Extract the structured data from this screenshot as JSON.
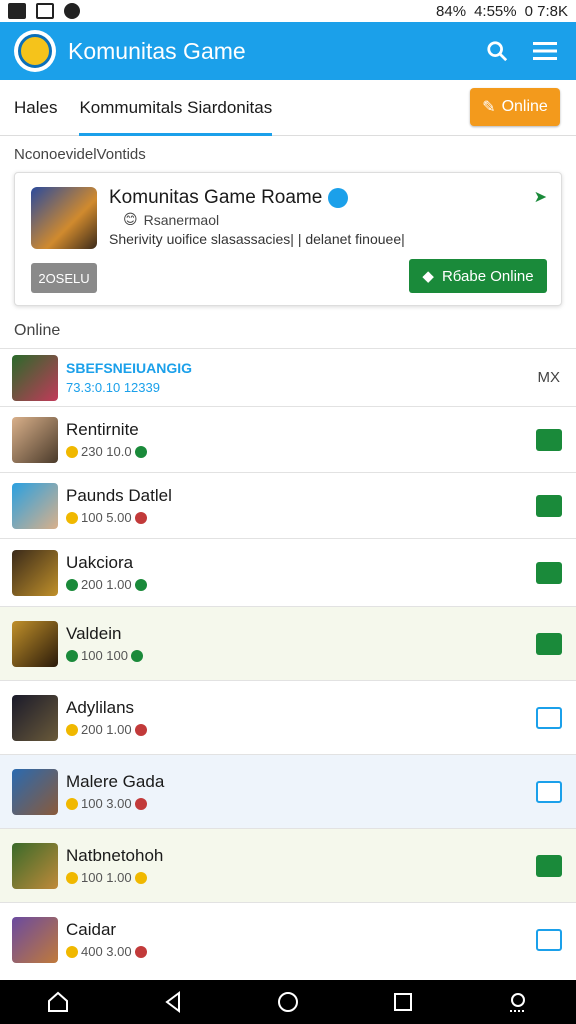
{
  "status_bar": {
    "battery": "84%",
    "time": "4:55%",
    "data": "0 7:8K"
  },
  "app": {
    "title": "Komunitas Game"
  },
  "tabs": [
    {
      "label": "Hales"
    },
    {
      "label": "Kommumitals Siardonitas"
    }
  ],
  "online_button": {
    "label": "Online"
  },
  "section1": "NconoevidelVontids",
  "featured": {
    "name": "Komunitas Game  Roame",
    "sub": "Rsanermaol",
    "desc": "Sherivity uoifice slasassacies| | delanet finouee|",
    "tag": "2OSELU",
    "button": "Rбаbe Online"
  },
  "section2": "Online",
  "list": [
    {
      "name": "SBEFSNEIUANGIG",
      "stats": "73.3:0.10 12339",
      "action": "MX",
      "highlight": false
    },
    {
      "name": "Rentirnite",
      "stats": "230  10.0",
      "highlight": false
    },
    {
      "name": "Paunds  Datlel",
      "stats": "100  5.00",
      "highlight": false
    },
    {
      "name": "Uakciora",
      "stats": "200  1.00",
      "highlight": false
    },
    {
      "name": "Valdein",
      "stats": "100  100",
      "highlight": true
    },
    {
      "name": "Adylilans",
      "stats": "200  1.00",
      "highlight": false
    },
    {
      "name": "Malere Gada",
      "stats": "100  3.00",
      "highlight": true
    },
    {
      "name": "Natbnetohoh",
      "stats": "100  1.00",
      "highlight": true
    },
    {
      "name": "Caidar",
      "stats": "400  3.00",
      "highlight": false
    }
  ],
  "colors": {
    "accent": "#1ba0ea",
    "green": "#1a8a3a",
    "orange": "#f39a1c"
  }
}
